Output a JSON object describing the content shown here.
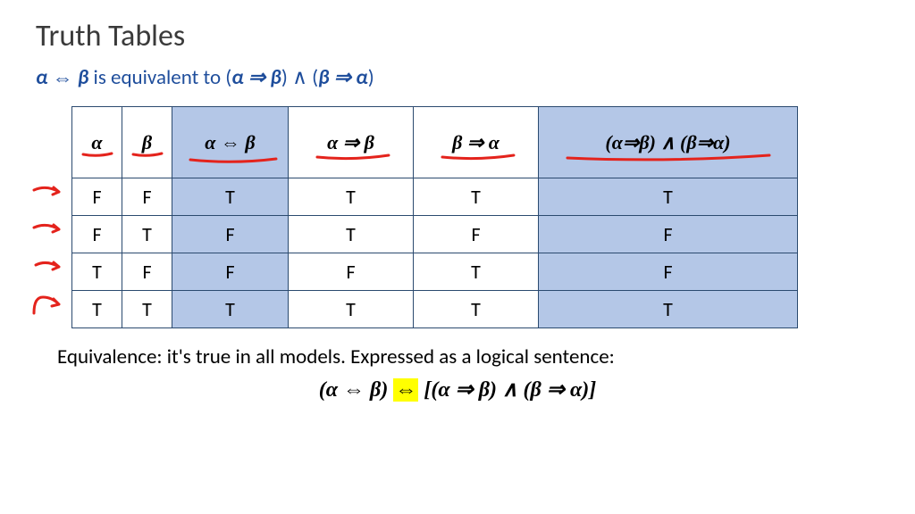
{
  "title": "Truth Tables",
  "subtitle_parts": {
    "a": "α",
    "iff": "⇔",
    "b": "β",
    "text": " is equivalent to (",
    "imp1a": "α",
    "imp1": "⇒",
    "imp1b": "β",
    "mid": ") ∧ (",
    "imp2a": "β",
    "imp2": "⇒",
    "imp2b": "α",
    "end": ")"
  },
  "chart_data": {
    "type": "table",
    "columns": [
      "α",
      "β",
      "α ⇔ β",
      "α ⇒ β",
      "β ⇒ α",
      "(α⇒β) ∧ (β⇒α)"
    ],
    "highlighted_columns": [
      2,
      5
    ],
    "rows": [
      [
        "F",
        "F",
        "T",
        "T",
        "T",
        "T"
      ],
      [
        "F",
        "T",
        "F",
        "T",
        "F",
        "F"
      ],
      [
        "T",
        "F",
        "F",
        "F",
        "T",
        "F"
      ],
      [
        "T",
        "T",
        "T",
        "T",
        "T",
        "T"
      ]
    ]
  },
  "footer": "Equivalence: it's true in all models. Expressed as a logical sentence:",
  "formula": {
    "left": "(α ⇔ β)",
    "mid": "⇔",
    "right": "[(α ⇒ β) ∧ (β ⇒ α)]"
  }
}
